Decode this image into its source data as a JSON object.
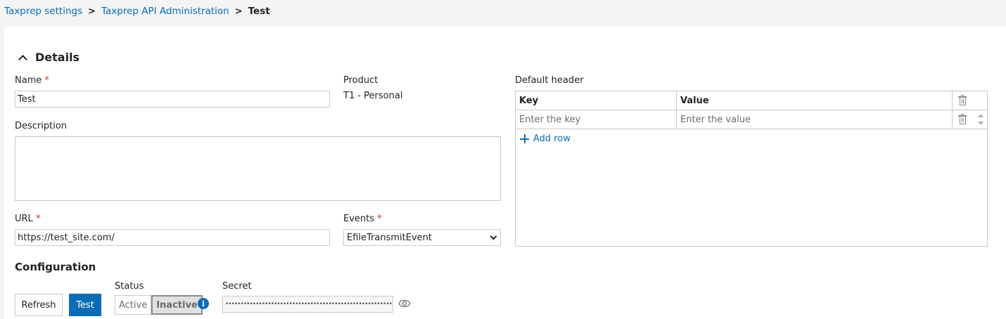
{
  "breadcrumb": {
    "items": [
      "Taxprep settings",
      "Taxprep API Administration"
    ],
    "current": "Test",
    "separator": ">"
  },
  "details": {
    "title": "Details",
    "name_label": "Name",
    "name_value": "Test",
    "required_mark": "*",
    "product_label": "Product",
    "product_value": "T1 - Personal",
    "description_label": "Description",
    "description_value": "",
    "url_label": "URL",
    "url_value": "https://test_site.com/",
    "events_label": "Events",
    "events_value": "EfileTransmitEvent"
  },
  "default_header": {
    "label": "Default header",
    "columns": [
      "Key",
      "Value"
    ],
    "key_placeholder": "Enter the key",
    "value_placeholder": "Enter the value",
    "add_row_label": "Add row"
  },
  "configuration": {
    "title": "Configuration",
    "refresh_label": "Refresh",
    "test_label": "Test",
    "status_label": "Status",
    "status_options": [
      "Active",
      "Inactive"
    ],
    "status_selected": "Inactive",
    "info_glyph": "i",
    "secret_label": "Secret",
    "secret_value": "••••••••••••••••••••••••••••••••••••••••••••••••••••••••••••••••"
  },
  "colors": {
    "accent": "#0b6db6",
    "required": "#d52b1e",
    "border": "#c9c9c9"
  },
  "icons": [
    "chevron-up-icon",
    "trash-icon",
    "plus-icon",
    "info-icon",
    "eye-icon",
    "chevron-down-icon"
  ]
}
